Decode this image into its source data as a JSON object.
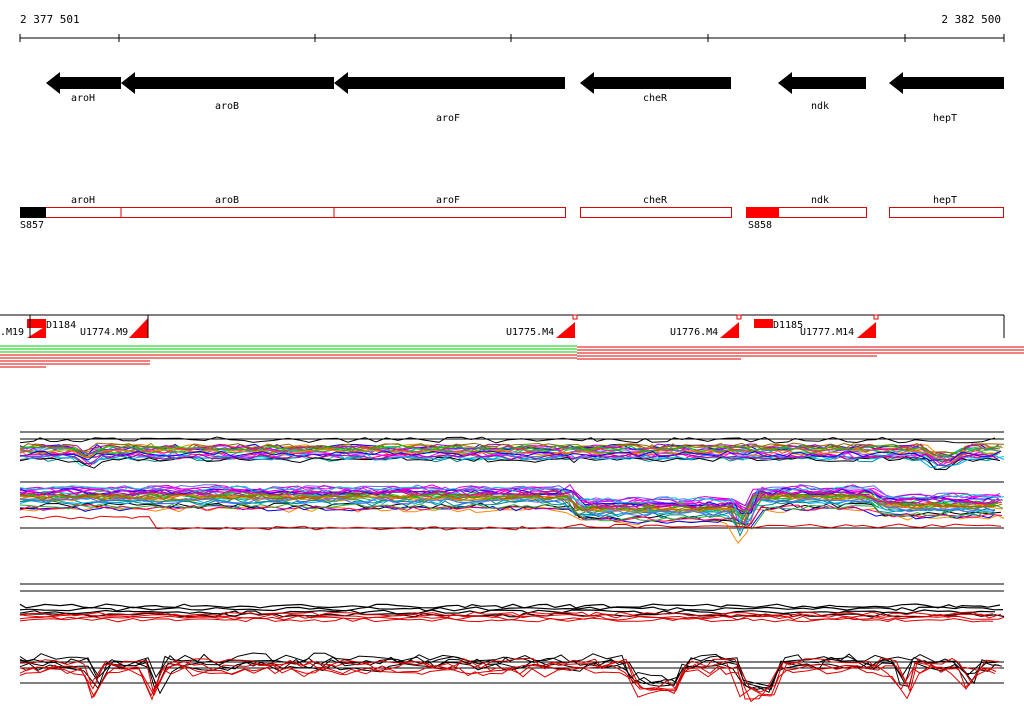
{
  "ruler": {
    "start_label": "2 377 501",
    "end_label": "2 382 500",
    "start": 2377501,
    "end": 2382500
  },
  "genes": [
    {
      "name": "aroH",
      "strand": "-"
    },
    {
      "name": "aroB",
      "strand": "-"
    },
    {
      "name": "aroF",
      "strand": "-"
    },
    {
      "name": "cheR",
      "strand": "-"
    },
    {
      "name": "ndk",
      "strand": "-"
    },
    {
      "name": "hepT",
      "strand": "-"
    }
  ],
  "operon_track": {
    "labels": [
      "aroH",
      "aroB",
      "aroF",
      "cheR",
      "ndk",
      "hepT"
    ],
    "starts": [
      "S857",
      "S858"
    ]
  },
  "features": {
    "downstream": [
      "D1184",
      "D1185"
    ],
    "upstream": [
      ".M19",
      "U1774.M9",
      "U1775.M4",
      "U1776.M4",
      "U1777.M14"
    ]
  },
  "colors": {
    "gene_arrow": "#000000",
    "operon_outline": "#e00000",
    "start_marker_black": "#000000",
    "start_marker_red": "#ff0000",
    "conserved_green": "#00cc00",
    "red_line": "#dd0000",
    "axis": "#000000"
  }
}
